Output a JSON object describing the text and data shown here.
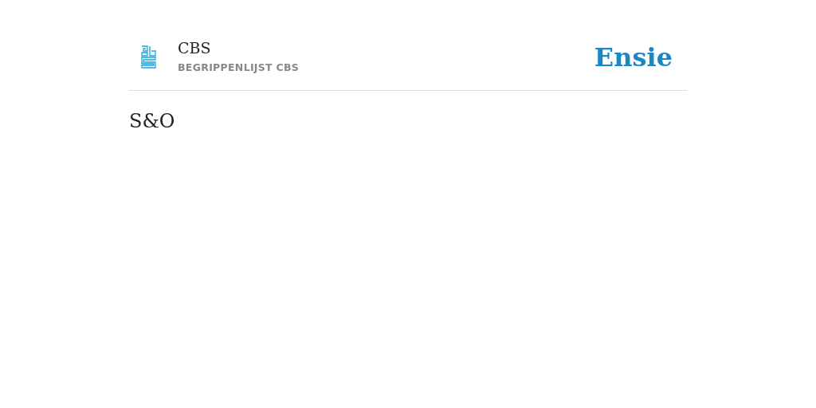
{
  "header": {
    "title": "CBS",
    "subtitle": "BEGRIPPENLIJST CBS",
    "logo_text": "Ensie"
  },
  "term": {
    "title": "S&O"
  }
}
